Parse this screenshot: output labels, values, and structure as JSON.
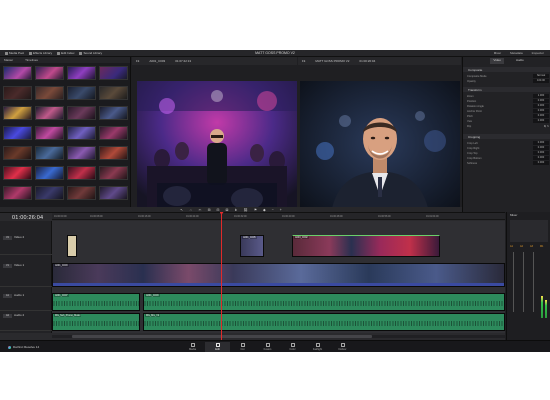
{
  "topbar": {
    "items": [
      "Media Pool",
      "Effects Library",
      "Edit Index",
      "Sound Library"
    ],
    "project_title": "MATT GOSS PROMO V2",
    "right_items": [
      "Mixer",
      "Metadata",
      "Inspector"
    ]
  },
  "media_pool": {
    "bin_label": "Master",
    "filter_label": "Timelines"
  },
  "source_bar": {
    "fit": "Fit",
    "clip_name": "A001_C003",
    "timecode": "01:07:42:13"
  },
  "program_bar": {
    "fit": "Fit",
    "timeline_name": "MATT GOSS PROMO V2",
    "timecode": "01:00:26:04"
  },
  "inspector": {
    "tabs": [
      "Video",
      "Audio"
    ],
    "sections": [
      "Composite",
      "Transform",
      "Cropping"
    ],
    "composite": [
      [
        "Composite Mode",
        "Normal"
      ],
      [
        "Opacity",
        "100.00"
      ]
    ],
    "transform": [
      [
        "Zoom",
        "1.000"
      ],
      [
        "Position",
        "0.000"
      ],
      [
        "Rotation Angle",
        "0.000"
      ],
      [
        "Anchor Point",
        "0.000"
      ],
      [
        "Pitch",
        "0.000"
      ],
      [
        "Yaw",
        "0.000"
      ],
      [
        "Flip",
        ""
      ]
    ],
    "cropping": [
      [
        "Crop Left",
        "0.000"
      ],
      [
        "Crop Right",
        "0.000"
      ],
      [
        "Crop Top",
        "0.000"
      ],
      [
        "Crop Bottom",
        "0.000"
      ],
      [
        "Softness",
        "0.000"
      ]
    ]
  },
  "timeline": {
    "timecode": "01:00:26:04",
    "ticks": [
      "01:00:00:00",
      "01:00:08:00",
      "01:00:16:00",
      "01:00:24:00",
      "01:00:32:00",
      "01:00:40:00",
      "01:00:48:00",
      "01:00:56:00",
      "01:01:04:00"
    ],
    "tracks": {
      "v2": {
        "tag": "V2",
        "name": "Video 2"
      },
      "v1": {
        "tag": "V1",
        "name": "Video 1"
      },
      "a1": {
        "tag": "A1",
        "name": "Audio 1"
      },
      "a2": {
        "tag": "A2",
        "name": "Audio 2"
      }
    },
    "clips": {
      "v2a": "A001_C005",
      "v2b": "A003_C002",
      "v1a": "A001_C003",
      "a1a": "A001_C007",
      "a1b": "A001_C003",
      "a2a": "MG_Sub_Promo_Music",
      "a2b": "MG_Mix_V2"
    }
  },
  "mixer": {
    "title": "Mixer",
    "channels": [
      "A1",
      "A2",
      "A3",
      "M1"
    ]
  },
  "pagebar": {
    "brand": "DaVinci Resolve 14",
    "pages": [
      "Media",
      "Edit",
      "Cut",
      "Fusion",
      "Color",
      "Fairlight",
      "Deliver"
    ],
    "active_page": "Edit"
  }
}
